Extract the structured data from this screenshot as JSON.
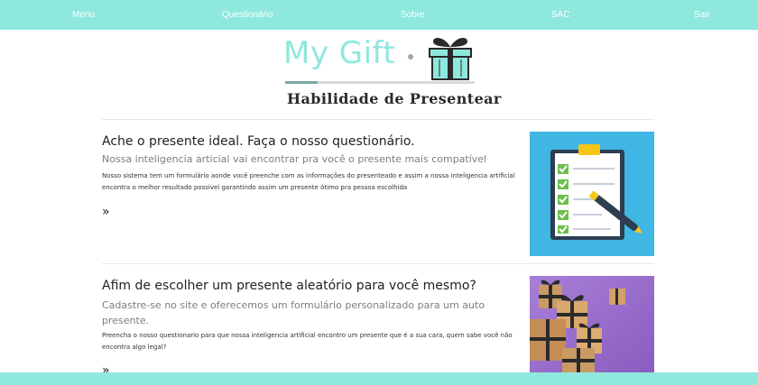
{
  "nav": {
    "items": [
      {
        "label": "Menu"
      },
      {
        "label": "Questionário"
      },
      {
        "label": "Sobre"
      },
      {
        "label": "SAC"
      },
      {
        "label": "Sair"
      }
    ]
  },
  "logo": {
    "title": "My Gift",
    "subtitle": "Habilidade de Presentear",
    "progress": 0.17
  },
  "features": [
    {
      "title": "Ache o presente ideal. Faça o nosso questionário.",
      "lead": "Nossa inteligencia articial vai encontrar pra você o presente mais compatível",
      "body": "Nosso sistema tem um formulário aonde você preenche com as informações do presenteado e assim a nossa inteligencia artificial encontra o melhor resultado possivel garantindo assim um presente ótimo pra pessoa escolhida",
      "more": "»",
      "image": "clipboard-checklist-illustration"
    },
    {
      "title": "Afim de escolher um presente aleatório para você mesmo?",
      "lead": "Cadastre-se no site e oferecemos um formulário personalizado para um auto presente.",
      "body": "Preencha o nosso questionario para que nossa inteligencia artificial encontro um presente que é a sua cara, quem sabe você não encontra algo legal?",
      "more": "»",
      "image": "gift-boxes-photo"
    }
  ],
  "colors": {
    "accent": "#8ee8dd",
    "lead_text": "#7a7f86",
    "clipboard_bg": "#3fb6e3",
    "photo_bg": "#9b6bc9"
  }
}
